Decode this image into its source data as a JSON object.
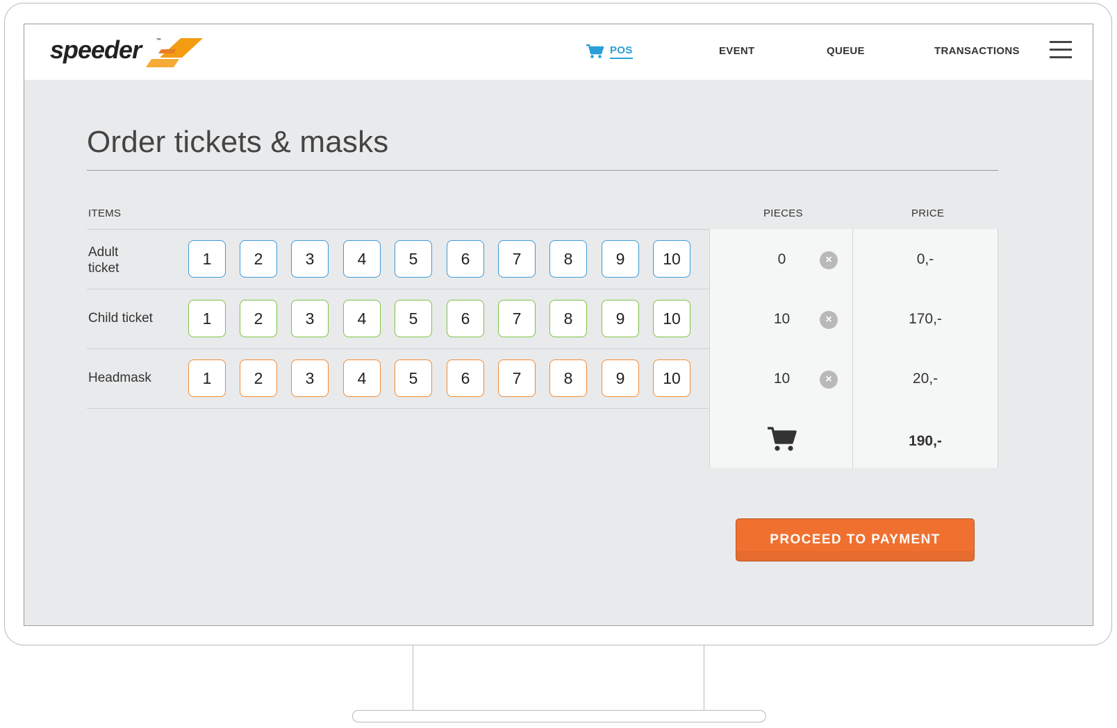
{
  "brand": {
    "name": "speeder",
    "trademark": "™",
    "accent": "#f39c12"
  },
  "nav": {
    "items": [
      {
        "label": "POS",
        "active": true,
        "icon": "cart-icon"
      },
      {
        "label": "EVENT",
        "active": false
      },
      {
        "label": "QUEUE",
        "active": false
      },
      {
        "label": "TRANSACTIONS",
        "active": false
      }
    ],
    "menu_icon": "hamburger-icon"
  },
  "page": {
    "title": "Order tickets & masks"
  },
  "table": {
    "headers": {
      "items": "ITEMS",
      "pieces": "PIECES",
      "price": "PRICE"
    },
    "quantity_options": [
      "1",
      "2",
      "3",
      "4",
      "5",
      "6",
      "7",
      "8",
      "9",
      "10"
    ],
    "rows": [
      {
        "label_lines": [
          "Adult",
          "ticket"
        ],
        "color": "#3a9ad9",
        "pieces": "0",
        "price": "0,-"
      },
      {
        "label_lines": [
          "Child ticket"
        ],
        "color": "#7cc242",
        "pieces": "10",
        "price": "170,-"
      },
      {
        "label_lines": [
          "Headmask"
        ],
        "color": "#f08a33",
        "pieces": "10",
        "price": "20,-"
      }
    ],
    "total": {
      "icon": "cart-icon",
      "value": "190,-"
    }
  },
  "actions": {
    "proceed_label": "PROCEED TO PAYMENT",
    "proceed_color": "#f07030"
  }
}
